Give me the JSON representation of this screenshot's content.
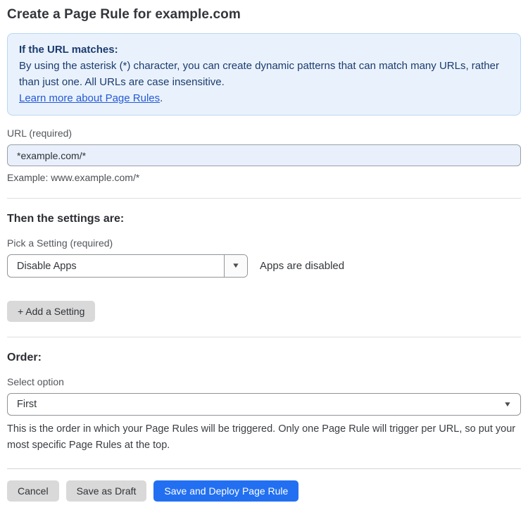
{
  "page": {
    "title": "Create a Page Rule for example.com"
  },
  "info_box": {
    "heading": "If the URL matches:",
    "body": "By using the asterisk (*) character, you can create dynamic patterns that can match many URLs, rather than just one. All URLs are case insensitive.",
    "link_label": "Learn more about Page Rules",
    "link_suffix": "."
  },
  "url_field": {
    "label": "URL (required)",
    "value": "*example.com/*",
    "hint": "Example: www.example.com/*"
  },
  "settings_section": {
    "heading": "Then the settings are:",
    "setting_label": "Pick a Setting (required)",
    "setting_value": "Disable Apps",
    "setting_status": "Apps are disabled",
    "add_setting_label": "+ Add a Setting"
  },
  "order_section": {
    "heading": "Order:",
    "label": "Select option",
    "value": "First",
    "help": "This is the order in which your Page Rules will be triggered. Only one Page Rule will trigger per URL, so put your most specific Page Rules at the top."
  },
  "footer": {
    "cancel_label": "Cancel",
    "save_draft_label": "Save as Draft",
    "save_deploy_label": "Save and Deploy Page Rule"
  },
  "icons": {
    "dropdown_caret": "▼"
  },
  "colors": {
    "accent_blue": "#2270f1",
    "info_bg": "#e9f2fc",
    "info_border": "#b9d6f3",
    "info_text": "#1b3b6f",
    "link_blue": "#2458d6",
    "input_focus_bg": "#e9f0fb"
  }
}
